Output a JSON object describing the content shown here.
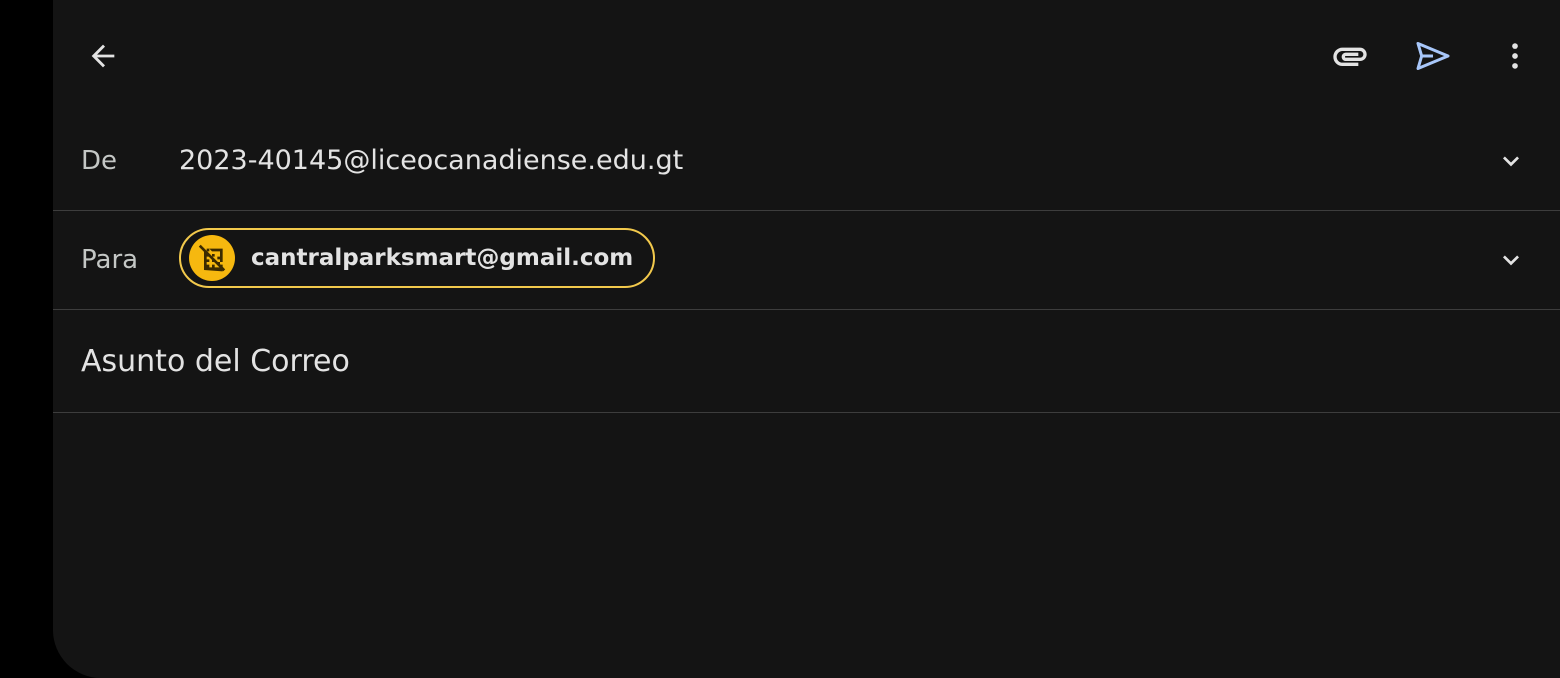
{
  "toolbar": {
    "back_icon": "arrow-left-icon",
    "attach_icon": "paperclip-icon",
    "send_icon": "send-icon",
    "more_icon": "more-vertical-icon",
    "send_color": "#a8c7fa"
  },
  "from": {
    "label": "De",
    "value": "2023-40145@liceocanadiense.edu.gt"
  },
  "to": {
    "label": "Para",
    "recipient": "cantralparksmart@gmail.com",
    "avatar_icon": "domain-disabled-icon",
    "avatar_color": "#f6b80f",
    "chip_border_color": "#f2c94c"
  },
  "subject": {
    "value": "Asunto del Correo"
  },
  "body": {
    "value": ""
  }
}
